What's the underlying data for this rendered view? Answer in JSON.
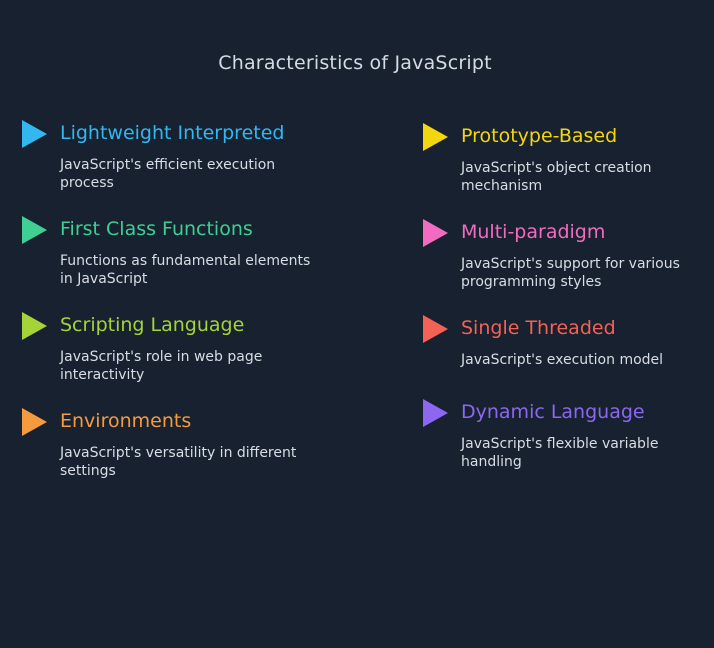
{
  "title": "Characteristics of JavaScript",
  "left_items": [
    {
      "title": "Lightweight Interpreted",
      "description": "JavaScript's efficient execution process",
      "color": "#33b7f0"
    },
    {
      "title": "First Class Functions",
      "description": "Functions as fundamental elements in JavaScript",
      "color": "#3fcf94"
    },
    {
      "title": "Scripting Language",
      "description": "JavaScript's role in web page interactivity",
      "color": "#a4d438"
    },
    {
      "title": "Environments",
      "description": "JavaScript's versatility in different settings",
      "color": "#f59a3f"
    }
  ],
  "right_items": [
    {
      "title": "Prototype-Based",
      "description": "JavaScript's object creation mechanism",
      "color": "#f4d60e"
    },
    {
      "title": "Multi-paradigm",
      "description": "JavaScript's support for various programming styles",
      "color": "#f36bc1"
    },
    {
      "title": "Single Threaded",
      "description": "JavaScript's execution model",
      "color": "#f46155"
    },
    {
      "title": "Dynamic Language",
      "description": "JavaScript's flexible variable handling",
      "color": "#8c67f1"
    }
  ]
}
